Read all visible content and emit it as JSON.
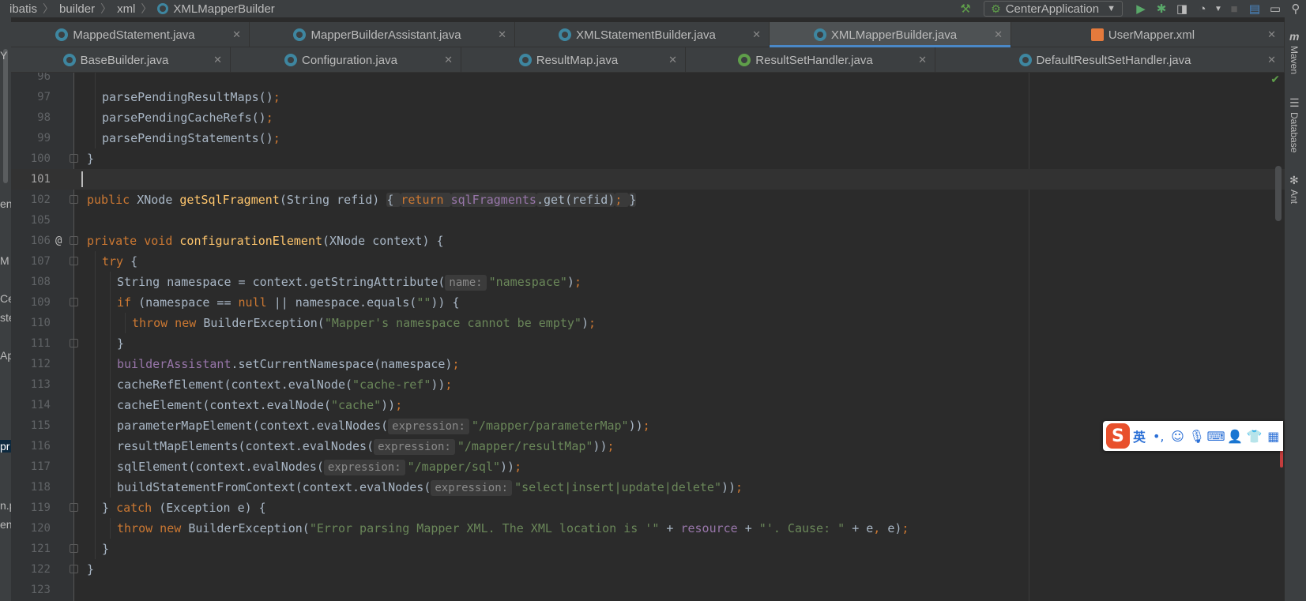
{
  "breadcrumb": [
    "ibatis",
    "builder",
    "xml",
    "XMLMapperBuilder"
  ],
  "run_config": "CenterApplication",
  "icons": {
    "build": "hammer-icon",
    "run": "run-icon",
    "debug": "bug-icon",
    "coverage": "coverage-icon",
    "profile": "profile-icon",
    "stop": "stop-icon",
    "project_structure": "structure-icon",
    "layout": "window-icon",
    "search": "search-icon"
  },
  "tabs_row1": [
    {
      "label": "MappedStatement.java",
      "icon": "class",
      "active": false
    },
    {
      "label": "MapperBuilderAssistant.java",
      "icon": "class",
      "active": false
    },
    {
      "label": "XMLStatementBuilder.java",
      "icon": "class",
      "active": false
    },
    {
      "label": "XMLMapperBuilder.java",
      "icon": "class",
      "active": true
    },
    {
      "label": "UserMapper.xml",
      "icon": "xml",
      "active": false
    }
  ],
  "tabs_row2": [
    {
      "label": "BaseBuilder.java",
      "icon": "class"
    },
    {
      "label": "Configuration.java",
      "icon": "class"
    },
    {
      "label": "ResultMap.java",
      "icon": "class"
    },
    {
      "label": "ResultSetHandler.java",
      "icon": "interface"
    },
    {
      "label": "DefaultResultSetHandler.java",
      "icon": "class"
    }
  ],
  "right_tools": [
    "Maven",
    "Database",
    "Ant"
  ],
  "left_fragments": [
    "Y",
    "en",
    "M",
    "Ce",
    "ste",
    "Ap",
    "pr",
    "n.p",
    "en"
  ],
  "ime": {
    "logo": "S",
    "mode": "英"
  },
  "colors": {
    "keyword": "#cc7832",
    "string": "#6a8759",
    "method": "#ffc66d",
    "field": "#9876aa",
    "text": "#a9b7c6",
    "accent": "#4a88c7"
  },
  "code_lines": [
    {
      "n": "96",
      "indent": 2,
      "parts": []
    },
    {
      "n": "97",
      "indent": 2,
      "parts": [
        [
          "ph",
          "parsePendingResultMaps()"
        ],
        [
          "kw",
          ";"
        ]
      ]
    },
    {
      "n": "98",
      "indent": 2,
      "parts": [
        [
          "ph",
          "parsePendingCacheRefs()"
        ],
        [
          "kw",
          ";"
        ]
      ]
    },
    {
      "n": "99",
      "indent": 2,
      "parts": [
        [
          "ph",
          "parsePendingStatements()"
        ],
        [
          "kw",
          ";"
        ]
      ]
    },
    {
      "n": "100",
      "indent": 1,
      "fold": true,
      "parts": [
        [
          "ph",
          "}"
        ]
      ]
    },
    {
      "n": "101",
      "indent": 0,
      "current": true,
      "parts": []
    },
    {
      "n": "102",
      "indent": 1,
      "fold": true,
      "parts": [
        [
          "kw",
          "public "
        ],
        [
          "ph",
          "XNode "
        ],
        [
          "fn",
          "getSqlFragment"
        ],
        [
          "ph",
          "(String refid) "
        ],
        [
          "blk",
          "{ "
        ],
        [
          "kwb",
          "return "
        ],
        [
          "fldb",
          "sqlFragments"
        ],
        [
          "blk",
          ".get(refid)"
        ],
        [
          "kwb",
          "; "
        ],
        [
          "blk",
          "}"
        ]
      ]
    },
    {
      "n": "105",
      "indent": 0,
      "parts": []
    },
    {
      "n": "106",
      "indent": 1,
      "fold": true,
      "at": true,
      "parts": [
        [
          "kw",
          "private void "
        ],
        [
          "fn",
          "configurationElement"
        ],
        [
          "ph",
          "(XNode context) {"
        ]
      ]
    },
    {
      "n": "107",
      "indent": 2,
      "fold": true,
      "parts": [
        [
          "kw",
          "try "
        ],
        [
          "ph",
          "{"
        ]
      ]
    },
    {
      "n": "108",
      "indent": 3,
      "parts": [
        [
          "ph",
          "String namespace = context.getStringAttribute("
        ],
        [
          "hint",
          "name:"
        ],
        [
          "str",
          "\"namespace\""
        ],
        [
          "ph",
          ")"
        ],
        [
          "kw",
          ";"
        ]
      ]
    },
    {
      "n": "109",
      "indent": 3,
      "fold": true,
      "parts": [
        [
          "kw",
          "if "
        ],
        [
          "ph",
          "(namespace == "
        ],
        [
          "kw",
          "null "
        ],
        [
          "ph",
          "|| namespace.equals("
        ],
        [
          "str",
          "\"\""
        ],
        [
          "ph",
          ")) {"
        ]
      ]
    },
    {
      "n": "110",
      "indent": 4,
      "parts": [
        [
          "kw",
          "throw new "
        ],
        [
          "ph",
          "BuilderException("
        ],
        [
          "str",
          "\"Mapper's namespace cannot be empty\""
        ],
        [
          "ph",
          ")"
        ],
        [
          "kw",
          ";"
        ]
      ]
    },
    {
      "n": "111",
      "indent": 3,
      "fold": true,
      "parts": [
        [
          "ph",
          "}"
        ]
      ]
    },
    {
      "n": "112",
      "indent": 3,
      "parts": [
        [
          "fld",
          "builderAssistant"
        ],
        [
          "ph",
          ".setCurrentNamespace(namespace)"
        ],
        [
          "kw",
          ";"
        ]
      ]
    },
    {
      "n": "113",
      "indent": 3,
      "parts": [
        [
          "ph",
          "cacheRefElement(context.evalNode("
        ],
        [
          "str",
          "\"cache-ref\""
        ],
        [
          "ph",
          "))"
        ],
        [
          "kw",
          ";"
        ]
      ]
    },
    {
      "n": "114",
      "indent": 3,
      "parts": [
        [
          "ph",
          "cacheElement(context.evalNode("
        ],
        [
          "str",
          "\"cache\""
        ],
        [
          "ph",
          "))"
        ],
        [
          "kw",
          ";"
        ]
      ]
    },
    {
      "n": "115",
      "indent": 3,
      "parts": [
        [
          "ph",
          "parameterMapElement(context.evalNodes("
        ],
        [
          "hint",
          "expression:"
        ],
        [
          "str",
          "\"/mapper/parameterMap\""
        ],
        [
          "ph",
          "))"
        ],
        [
          "kw",
          ";"
        ]
      ]
    },
    {
      "n": "116",
      "indent": 3,
      "parts": [
        [
          "ph",
          "resultMapElements(context.evalNodes("
        ],
        [
          "hint",
          "expression:"
        ],
        [
          "str",
          "\"/mapper/resultMap\""
        ],
        [
          "ph",
          "))"
        ],
        [
          "kw",
          ";"
        ]
      ]
    },
    {
      "n": "117",
      "indent": 3,
      "parts": [
        [
          "ph",
          "sqlElement(context.evalNodes("
        ],
        [
          "hint",
          "expression:"
        ],
        [
          "str",
          "\"/mapper/sql\""
        ],
        [
          "ph",
          "))"
        ],
        [
          "kw",
          ";"
        ]
      ]
    },
    {
      "n": "118",
      "indent": 3,
      "parts": [
        [
          "ph",
          "buildStatementFromContext(context.evalNodes("
        ],
        [
          "hint",
          "expression:"
        ],
        [
          "str",
          "\"select|insert|update|delete\""
        ],
        [
          "ph",
          "))"
        ],
        [
          "kw",
          ";"
        ]
      ]
    },
    {
      "n": "119",
      "indent": 2,
      "fold": true,
      "parts": [
        [
          "ph",
          "} "
        ],
        [
          "kw",
          "catch "
        ],
        [
          "ph",
          "(Exception e) {"
        ]
      ]
    },
    {
      "n": "120",
      "indent": 3,
      "parts": [
        [
          "kw",
          "throw new "
        ],
        [
          "ph",
          "BuilderException("
        ],
        [
          "str",
          "\"Error parsing Mapper XML. The XML location is '\""
        ],
        [
          "ph",
          " + "
        ],
        [
          "fld",
          "resource"
        ],
        [
          "ph",
          " + "
        ],
        [
          "str",
          "\"'. Cause: \""
        ],
        [
          "ph",
          " + e"
        ],
        [
          "kw",
          ", "
        ],
        [
          "ph",
          "e)"
        ],
        [
          "kw",
          ";"
        ]
      ]
    },
    {
      "n": "121",
      "indent": 2,
      "fold": true,
      "parts": [
        [
          "ph",
          "}"
        ]
      ]
    },
    {
      "n": "122",
      "indent": 1,
      "fold": true,
      "parts": [
        [
          "ph",
          "}"
        ]
      ]
    },
    {
      "n": "123",
      "indent": 0,
      "parts": []
    }
  ]
}
